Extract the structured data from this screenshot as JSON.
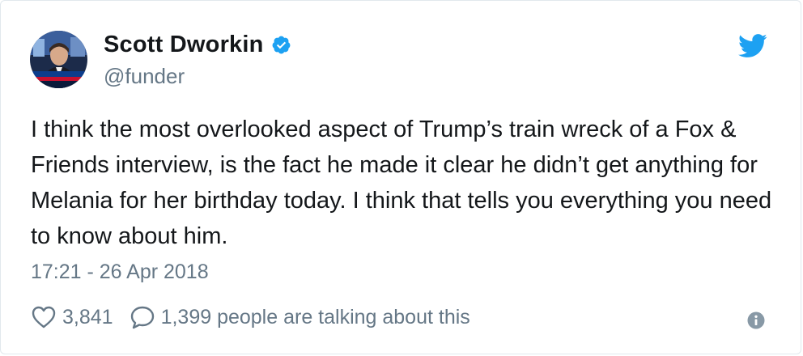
{
  "author": {
    "display_name": "Scott Dworkin",
    "handle": "@funder",
    "verified": true
  },
  "tweet": {
    "text": "I think the most overlooked aspect of Trump’s train wreck of a Fox & Friends interview, is the fact he made it clear he didn’t get anything for Melania for her birthday today. I think that tells you everything you need to know about him.",
    "timestamp": "17:21 - 26 Apr 2018"
  },
  "stats": {
    "likes": "3,841",
    "talking": "1,399 people are talking about this"
  },
  "icons": {
    "brand": "twitter-bird-icon",
    "like": "heart-icon",
    "reply": "speech-bubble-icon",
    "info": "info-icon",
    "verified": "verified-badge-icon"
  },
  "colors": {
    "brand_blue": "#1da1f2",
    "muted": "#657786",
    "text": "#14171a"
  }
}
